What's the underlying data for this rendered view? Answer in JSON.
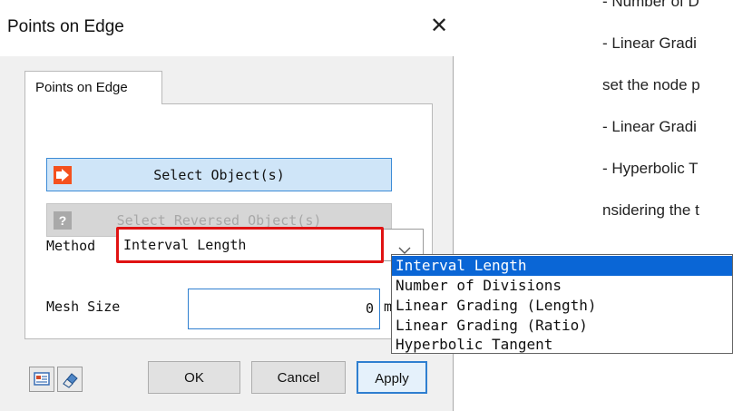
{
  "background_text": [
    "- Number of D",
    "- Linear Gradi",
    "set the node p",
    "- Linear Gradi",
    "- Hyperbolic T",
    "nsidering the t"
  ],
  "dialog": {
    "title": "Points on Edge",
    "close_glyph": "✕",
    "tab_label": "Points on Edge",
    "select_objects_label": "Select Object(s)",
    "select_reversed_label": "Select Reversed Object(s)",
    "method_label": "Method",
    "method_value": "Interval Length",
    "mesh_size_label": "Mesh Size",
    "mesh_size_value": "0",
    "mesh_size_unit": "m",
    "buttons": {
      "ok": "OK",
      "cancel": "Cancel",
      "apply": "Apply"
    },
    "help_glyph": "?"
  },
  "method_options": [
    {
      "label": "Interval Length",
      "selected": true
    },
    {
      "label": "Number of Divisions",
      "selected": false
    },
    {
      "label": "Linear Grading (Length)",
      "selected": false
    },
    {
      "label": "Linear Grading (Ratio)",
      "selected": false
    },
    {
      "label": "Hyperbolic Tangent",
      "selected": false
    }
  ],
  "colors": {
    "accent_blue": "#0a66d6",
    "highlight_red": "#e01212",
    "select_button_bg": "#cfe5f8",
    "select_icon": "#f4511e"
  },
  "icons": {
    "select_objects": "arrow-right-icon",
    "select_reversed": "help-icon",
    "footer_left_1": "preview-icon",
    "footer_left_2": "eraser-icon"
  }
}
